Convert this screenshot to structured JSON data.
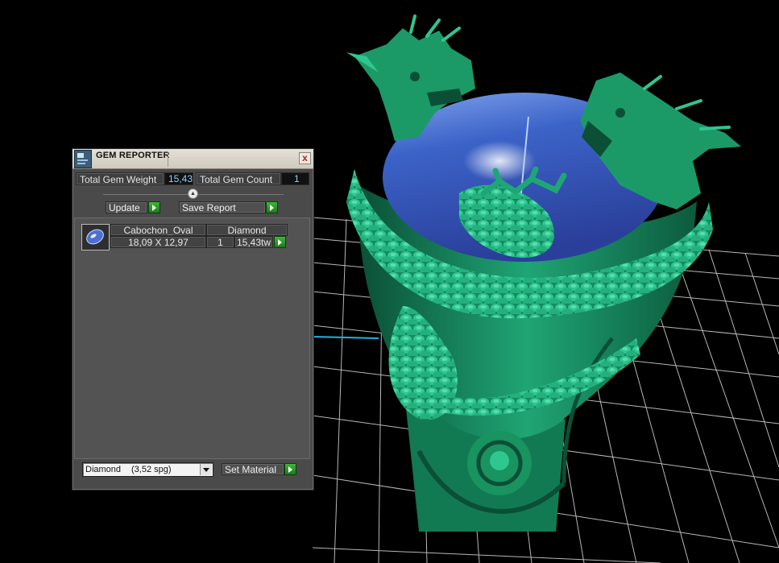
{
  "panel": {
    "title": "GEM REPORTER",
    "close_glyph": "x",
    "icons": {
      "app": "gem-reporter-icon",
      "close": "close-icon",
      "collapse": "collapse-up-icon",
      "go": "green-play-arrow-icon",
      "dropdown": "chevron-down-icon"
    },
    "total_weight_label": "Total Gem Weight",
    "total_weight_value": "15,43",
    "total_count_label": "Total Gem Count",
    "total_count_value": "1",
    "collapse_glyph": "▲",
    "update_label": "Update",
    "save_report_label": "Save Report",
    "gems": [
      {
        "shape": "Cabochon_Oval",
        "material": "Diamond",
        "size": "18,09 X 12,97",
        "count": "1",
        "weight": "15,43tw"
      }
    ],
    "material_select": {
      "name": "Diamond",
      "spg": "(3,52 spg)"
    },
    "set_material_label": "Set Material"
  },
  "colors": {
    "ring_green": "#1f9e6e",
    "gem_blue": "#3a63c4",
    "go_green": "#2f9a2b",
    "value_blue": "#8fd0ff",
    "grid_white": "#dcdcdc",
    "axis_cyan": "#1fb3e6"
  }
}
